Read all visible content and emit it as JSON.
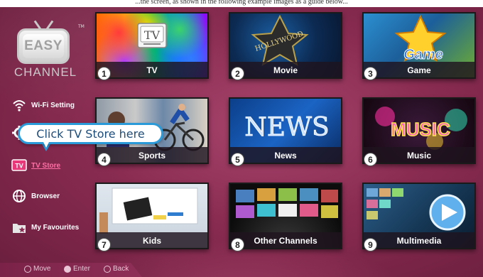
{
  "header": {
    "caption": "...the screen, as shown in the following example images as a guide below..."
  },
  "logo": {
    "mark": "EASY",
    "trademark": "TM",
    "name": "CHANNEL"
  },
  "sidebar": {
    "items": [
      {
        "label": "Wi-Fi Setting",
        "icon": "wifi-icon"
      },
      {
        "label": "",
        "icon": "gear-icon"
      },
      {
        "label": "TV Store",
        "icon": "tv-store-icon",
        "active": true,
        "icon_text": "TV"
      },
      {
        "label": "Browser",
        "icon": "globe-icon"
      },
      {
        "label": "My Favourites",
        "icon": "favourites-icon"
      }
    ]
  },
  "callout": {
    "text": "Click TV Store here"
  },
  "tiles": [
    {
      "number": "1",
      "label": "TV",
      "art_text": "TV"
    },
    {
      "number": "2",
      "label": "Movie",
      "art_text": "HOLLYWOOD"
    },
    {
      "number": "3",
      "label": "Game",
      "art_text": "Game"
    },
    {
      "number": "4",
      "label": "Sports",
      "art_text": ""
    },
    {
      "number": "5",
      "label": "News",
      "art_text": "NEWS"
    },
    {
      "number": "6",
      "label": "Music",
      "art_text": "MUSIC"
    },
    {
      "number": "7",
      "label": "Kids",
      "art_text": ""
    },
    {
      "number": "8",
      "label": "Other Channels",
      "art_text": ""
    },
    {
      "number": "9",
      "label": "Multimedia",
      "art_text": ""
    }
  ],
  "footer": {
    "hints": [
      {
        "label": "Move",
        "icon": "dpad-icon"
      },
      {
        "label": "Enter",
        "icon": "ok-icon"
      },
      {
        "label": "Back",
        "icon": "back-icon"
      }
    ]
  },
  "colors": {
    "background": "#8a2c52",
    "accent": "#ff6fa6",
    "callout_border": "#2a9ad8"
  }
}
